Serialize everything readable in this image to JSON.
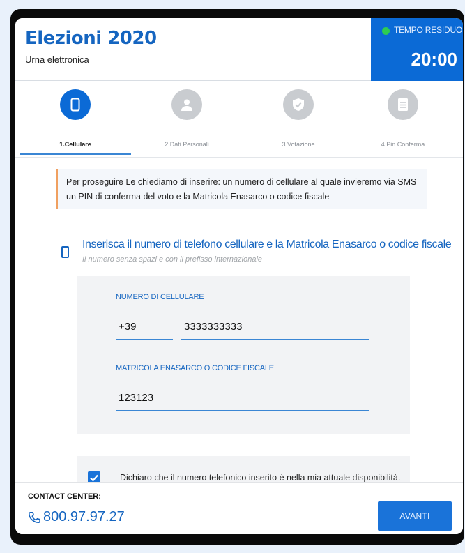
{
  "header": {
    "title": "Elezioni 2020",
    "subtitle": "Urna elettronica"
  },
  "timer": {
    "label": "TEMPO RESIDUO",
    "value": "20:00",
    "dot_color": "#2ecc52"
  },
  "steps": [
    {
      "label": "1.Cellulare",
      "icon": "phone-icon",
      "active": true
    },
    {
      "label": "2.Dati Personali",
      "icon": "person-icon",
      "active": false
    },
    {
      "label": "3.Votazione",
      "icon": "shield-check-icon",
      "active": false
    },
    {
      "label": "4.Pin Conferma",
      "icon": "document-icon",
      "active": false
    }
  ],
  "notice": {
    "text": "Per proseguire Le chiediamo di inserire: un numero di cellulare al quale invieremo via SMS un PIN di conferma del voto e la Matricola Enasarco o codice fiscale"
  },
  "section": {
    "title": "Inserisca il numero di telefono cellulare e la Matricola Enasarco o codice fiscale",
    "hint": "Il numero senza spazi e con il prefisso internazionale"
  },
  "form": {
    "phone_label": "NUMERO DI CELLULARE",
    "prefix_value": "+39",
    "phone_value": "3333333333",
    "matricola_label": "MATRICOLA ENASARCO O CODICE FISCALE",
    "matricola_value": "123123"
  },
  "consent": {
    "checked": true,
    "text": "Dichiaro che il numero telefonico inserito è nella mia attuale disponibilità."
  },
  "footer": {
    "contact_label": "CONTACT CENTER:",
    "phone": "800.97.97.27",
    "next_label": "AVANTI"
  },
  "colors": {
    "brand_blue": "#1565c0",
    "accent_blue": "#0b6ad6",
    "notice_border": "#f0a060",
    "inactive_step": "#c9ccd0"
  }
}
